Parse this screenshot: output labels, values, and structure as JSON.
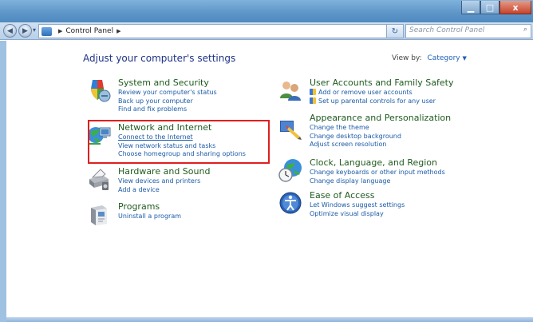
{
  "window": {
    "minimize_glyph": "▁",
    "maximize_glyph": "□",
    "close_glyph": "x"
  },
  "navbar": {
    "back_glyph": "◀",
    "forward_glyph": "▶",
    "dropdown_glyph": "▾",
    "address": "Control Panel",
    "address_sep": "▶",
    "address_trail_sep": "▶",
    "address_dropdown_glyph": "▾",
    "refresh_glyph": "↻",
    "search_placeholder": "Search Control Panel",
    "search_icon_glyph": "⌕"
  },
  "main": {
    "heading": "Adjust your computer's settings",
    "view_by_label": "View by:",
    "view_by_value": "Category",
    "view_by_arrow": "▼"
  },
  "categories_left": [
    {
      "title": "System and Security",
      "icon": "shield-icon",
      "links": [
        "Review your computer's status",
        "Back up your computer",
        "Find and fix problems"
      ]
    },
    {
      "title": "Network and Internet",
      "icon": "network-icon",
      "links": [
        "Connect to the Internet",
        "View network status and tasks",
        "Choose homegroup and sharing options"
      ]
    },
    {
      "title": "Hardware and Sound",
      "icon": "printer-icon",
      "links": [
        "View devices and printers",
        "Add a device"
      ]
    },
    {
      "title": "Programs",
      "icon": "programs-icon",
      "links": [
        "Uninstall a program"
      ]
    }
  ],
  "categories_right": [
    {
      "title": "User Accounts and Family Safety",
      "icon": "users-icon",
      "links": [
        "Add or remove user accounts",
        "Set up parental controls for any user"
      ]
    },
    {
      "title": "Appearance and Personalization",
      "icon": "appearance-icon",
      "links": [
        "Change the theme",
        "Change desktop background",
        "Adjust screen resolution"
      ]
    },
    {
      "title": "Clock, Language, and Region",
      "icon": "clock-globe-icon",
      "links": [
        "Change keyboards or other input methods",
        "Change display language"
      ]
    },
    {
      "title": "Ease of Access",
      "icon": "ease-of-access-icon",
      "links": [
        "Let Windows suggest settings",
        "Optimize visual display"
      ]
    }
  ],
  "colors": {
    "category_title": "#1f5b1f",
    "link": "#1c5ba8",
    "heading": "#1e3287",
    "highlight": "#e01f1f"
  }
}
